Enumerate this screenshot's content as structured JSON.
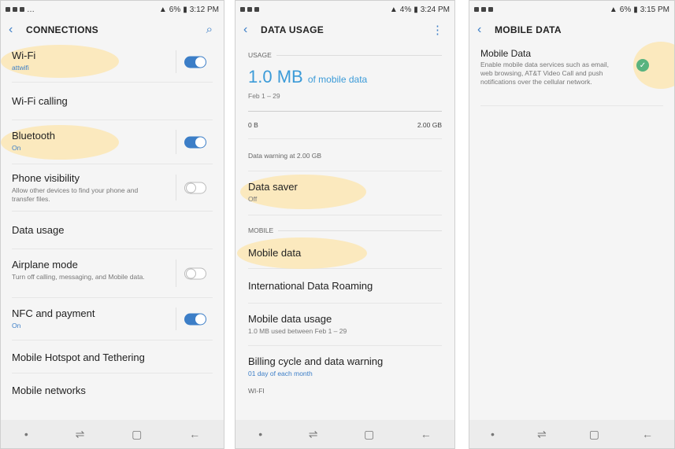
{
  "colors": {
    "accent": "#3c7ec7",
    "highlight": "#fbe6b4",
    "data_blue": "#3c9bd8",
    "check": "#58b37f"
  },
  "screen1": {
    "status_time": "3:12 PM",
    "status_battery": "6%",
    "title": "CONNECTIONS",
    "items": [
      {
        "title": "Wi-Fi",
        "sub": "attwifi"
      },
      {
        "title": "Wi-Fi calling",
        "sub": ""
      },
      {
        "title": "Bluetooth",
        "sub": "On"
      },
      {
        "title": "Phone visibility",
        "sub": "Allow other devices to find your phone and transfer files."
      },
      {
        "title": "Data usage",
        "sub": ""
      },
      {
        "title": "Airplane mode",
        "sub": "Turn off calling, messaging, and Mobile data."
      },
      {
        "title": "NFC and payment",
        "sub": "On"
      },
      {
        "title": "Mobile Hotspot and Tethering",
        "sub": ""
      },
      {
        "title": "Mobile networks",
        "sub": ""
      }
    ],
    "toggles": {
      "wifi": true,
      "bluetooth": true,
      "phone_visibility": false,
      "airplane_mode": false,
      "nfc": true
    }
  },
  "screen2": {
    "status_time": "3:24 PM",
    "status_battery": "4%",
    "title": "DATA USAGE",
    "usage_section": "USAGE",
    "usage_value": "1.0 MB",
    "usage_suffix": "of mobile data",
    "usage_period": "Feb 1 – 29",
    "scale_min": "0 B",
    "scale_max": "2.00 GB",
    "warning": "Data warning at 2.00 GB",
    "data_saver": {
      "title": "Data saver",
      "sub": "Off"
    },
    "mobile_section": "MOBILE",
    "mobile_data": "Mobile data",
    "roaming": "International Data Roaming",
    "mobile_usage": {
      "title": "Mobile data usage",
      "sub": "1.0 MB used between Feb 1 – 29"
    },
    "billing": {
      "title": "Billing cycle and data warning",
      "sub": "01 day of each month"
    },
    "wifi_section": "WI-FI"
  },
  "screen3": {
    "status_time": "3:15 PM",
    "status_battery": "6%",
    "title": "MOBILE DATA",
    "item_title": "Mobile Data",
    "item_sub": "Enable mobile data services such as email, web browsing, AT&T Video Call and push notifications over the cellular network.",
    "enabled": true
  },
  "icons": {
    "back": "‹",
    "search": "⌕",
    "more": "⋮",
    "check": "✓",
    "nav_dot": "•",
    "nav_recent": "⇌",
    "nav_home": "▢",
    "nav_back": "←"
  }
}
